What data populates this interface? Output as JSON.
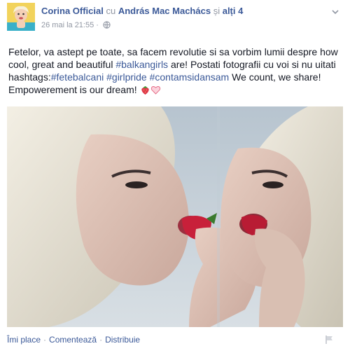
{
  "post": {
    "author": "Corina Official",
    "with_word": "cu",
    "tagged_person": "András Mac Machács",
    "and_word": "și",
    "others_link": "alți 4",
    "timestamp": "26 mai la 21:55",
    "text_part1": "Fetelor, va astept pe toate, sa facem revolutie si sa vorbim lumii despre how cool, great and beautiful ",
    "hashtag1": "#balkangirls",
    "text_part2": " are! Postati fotografii cu voi si nu uitati hashtags:",
    "hashtag2": "#fetebalcani",
    "hashtag3": "#girlpride",
    "hashtag4": "#contamsidansam",
    "text_part3": " We count, we share! Empowerement is our dream!"
  },
  "actions": {
    "like": "Îmi place",
    "comment": "Comentează",
    "share": "Distribuie"
  },
  "icons": {
    "audience": "globe-icon",
    "menu": "chevron-down-icon",
    "report": "flag-icon",
    "emoji1": "strawberry-emoji",
    "emoji2": "heart-emoji"
  },
  "colors": {
    "link": "#3b5998",
    "meta": "#9197a3",
    "text": "#141823"
  }
}
